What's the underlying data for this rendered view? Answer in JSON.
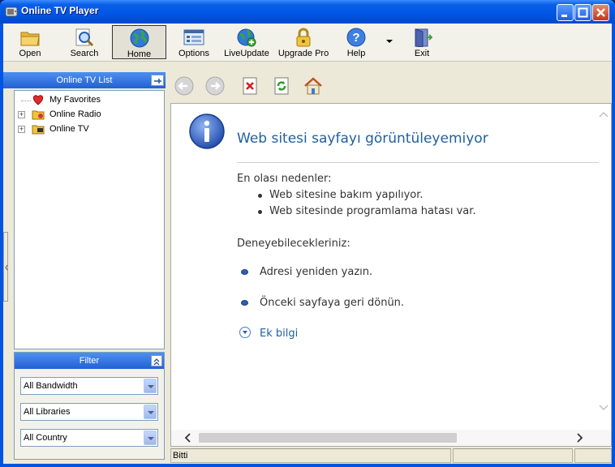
{
  "window": {
    "title": "Online TV Player"
  },
  "toolbar": {
    "open_label": "Open",
    "search_label": "Search",
    "home_label": "Home",
    "options_label": "Options",
    "liveupdate_label": "LiveUpdate",
    "upgrade_label": "Upgrade Pro",
    "help_label": "Help",
    "exit_label": "Exit"
  },
  "left_panel": {
    "list_title": "Online TV List",
    "tree": [
      {
        "label": "My Favorites"
      },
      {
        "label": "Online Radio"
      },
      {
        "label": "Online TV"
      }
    ],
    "filter_title": "Filter",
    "filters": [
      {
        "value": "All Bandwidth"
      },
      {
        "value": "All Libraries"
      },
      {
        "value": "All Country"
      }
    ]
  },
  "browser": {
    "heading": "Web sitesi sayfayı görüntüleyemiyor",
    "causes_title": "En olası nedenler:",
    "causes": [
      "Web sitesine bakım yapılıyor.",
      "Web sitesinde programlama hatası var."
    ],
    "try_title": "Deneyebilecekleriniz:",
    "try_items": [
      "Adresi yeniden yazın.",
      "Önceki sayfaya geri dönün."
    ],
    "more_info": "Ek bilgi"
  },
  "status": {
    "text": "Bitti"
  },
  "colors": {
    "accent": "#0054e3",
    "link": "#1f5f9e",
    "panel_header": "#2361d3"
  }
}
